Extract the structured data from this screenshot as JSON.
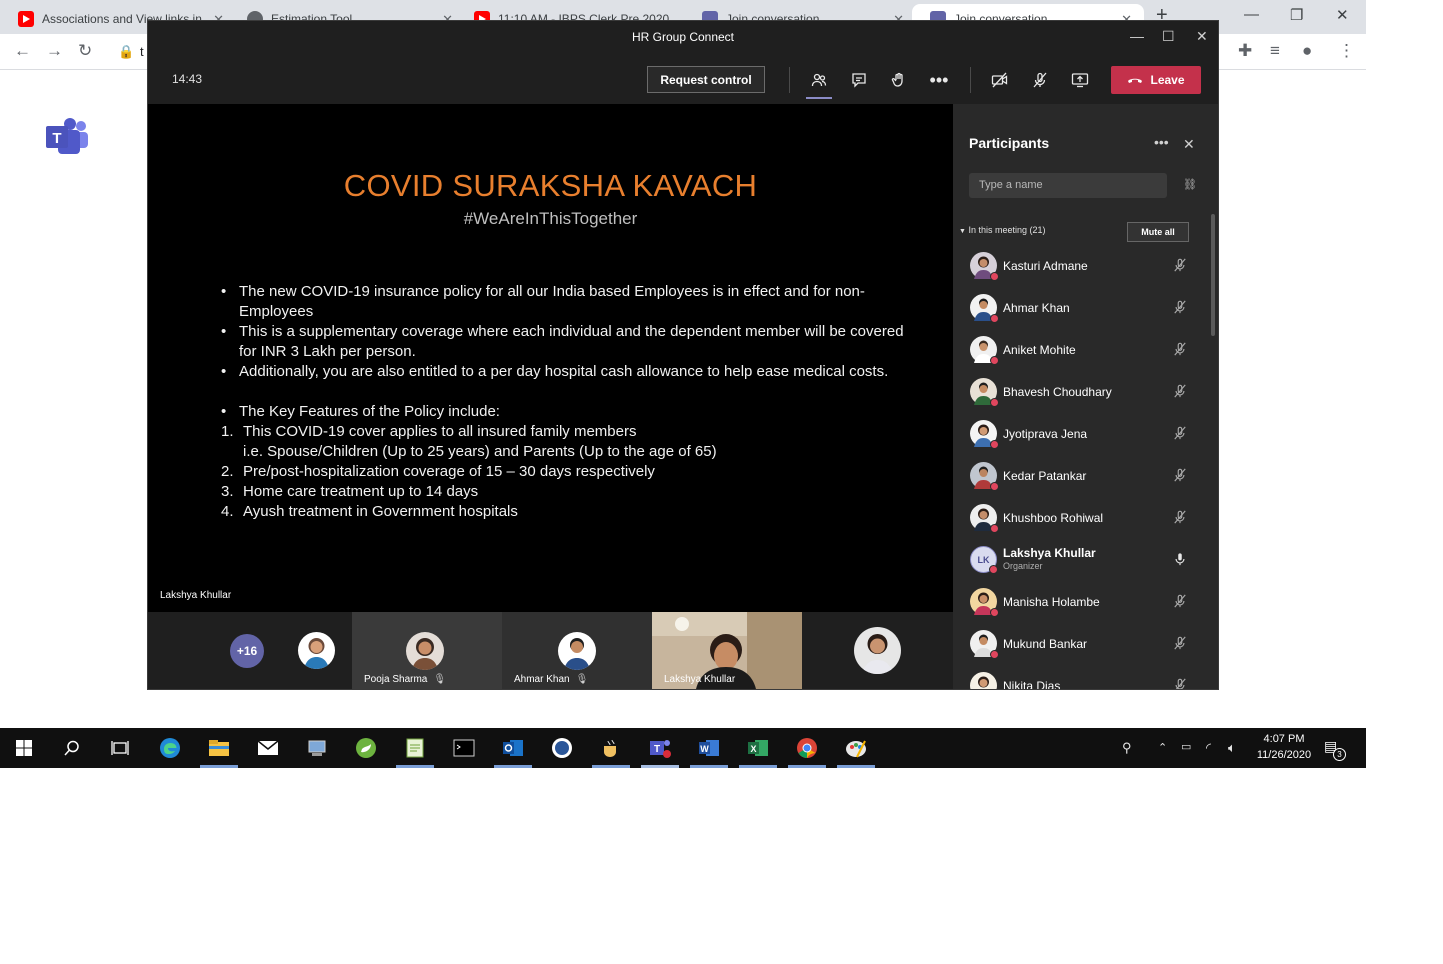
{
  "browser": {
    "tabs": [
      {
        "title": "Associations and View links in...",
        "favicon": "youtube-icon",
        "color": "#ff0000"
      },
      {
        "title": "Estimation Tool",
        "favicon": "globe-icon",
        "color": "#5f6368"
      },
      {
        "title": "11:10 AM - IBPS Clerk Pre 2020",
        "favicon": "youtube-icon",
        "color": "#ff0000"
      },
      {
        "title": "Join conversation",
        "favicon": "teams-icon",
        "color": "#6264a7"
      },
      {
        "title": "Join conversation",
        "favicon": "teams-icon",
        "color": "#6264a7"
      }
    ],
    "address_fragment": "t"
  },
  "teams": {
    "window_title": "HR Group Connect",
    "timer": "14:43",
    "request_control_label": "Request control",
    "leave_label": "Leave",
    "accent_color": "#6264a7",
    "leave_color": "#c4314b"
  },
  "slide": {
    "title": "COVID SURAKSHA KAVACH",
    "subtitle": "#WeAreInThisTogether",
    "bullets": [
      "The new COVID-19 insurance policy for all our India based Employees is in effect and for non-Employees",
      "This is a supplementary coverage where each individual and the dependent member will be covered for INR 3 Lakh per person.",
      "Additionally, you are also entitled to a per day hospital cash allowance to help ease medical costs."
    ],
    "key_features_heading": "The Key Features of the Policy include:",
    "features": [
      {
        "num": "1.",
        "line1": "This COVID-19 cover applies to all insured family members",
        "line2": "i.e. Spouse/Children (Up to 25 years) and Parents (Up to the age of 65)"
      },
      {
        "num": "2.",
        "line1": "Pre/post-hospitalization coverage of 15 – 30 days respectively",
        "line2": ""
      },
      {
        "num": "3.",
        "line1": "Home care treatment up to 14 days",
        "line2": ""
      },
      {
        "num": "4.",
        "line1": "Ayush treatment in Government hospitals",
        "line2": ""
      }
    ],
    "title_color": "#e87f2e"
  },
  "presenter_name": "Lakshya Khullar",
  "gallery": {
    "overflow_count": "+16",
    "tiles": [
      {
        "name": "Pooja Sharma"
      },
      {
        "name": "Ahmar Khan"
      },
      {
        "name": "Lakshya Khullar"
      }
    ]
  },
  "participants": {
    "title": "Participants",
    "search_placeholder": "Type a name",
    "section_label": "In this meeting (21)",
    "mute_all_label": "Mute all",
    "people": [
      {
        "name": "Kasturi Admane",
        "role": "",
        "mic": "muted"
      },
      {
        "name": "Ahmar Khan",
        "role": "",
        "mic": "muted"
      },
      {
        "name": "Aniket Mohite",
        "role": "",
        "mic": "muted"
      },
      {
        "name": "Bhavesh Choudhary",
        "role": "",
        "mic": "muted"
      },
      {
        "name": "Jyotiprava Jena",
        "role": "",
        "mic": "muted"
      },
      {
        "name": "Kedar Patankar",
        "role": "",
        "mic": "muted"
      },
      {
        "name": "Khushboo Rohiwal",
        "role": "",
        "mic": "muted"
      },
      {
        "name": "Lakshya Khullar",
        "role": "Organizer",
        "mic": "on",
        "initials": "LK"
      },
      {
        "name": "Manisha Holambe",
        "role": "",
        "mic": "muted"
      },
      {
        "name": "Mukund Bankar",
        "role": "",
        "mic": "muted"
      },
      {
        "name": "Nikita Dias",
        "role": "",
        "mic": "muted"
      }
    ]
  },
  "taskbar": {
    "time": "4:07 PM",
    "date": "11/26/2020",
    "notification_count": "3"
  }
}
